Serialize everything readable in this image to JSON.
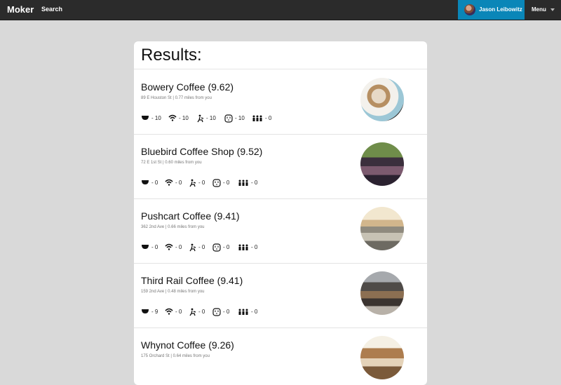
{
  "topbar": {
    "brand": "Moker",
    "search_label": "Search",
    "user_name": "Jason Leibowitz",
    "menu_label": "Menu"
  },
  "colors": {
    "topbar_bg": "#2b2b2b",
    "user_bg": "#0a86b8",
    "page_bg": "#d9d9d9"
  },
  "panel": {
    "title": "Results:"
  },
  "results": [
    {
      "name": "Bowery Coffee (9.62)",
      "meta": "89 E Houston St | 0.77 miles from you",
      "stats": {
        "coffee": "- 10",
        "wifi": "- 10",
        "seating": "- 10",
        "outlets": "- 10",
        "crowd": "- 0"
      }
    },
    {
      "name": "Bluebird Coffee Shop (9.52)",
      "meta": "72 E 1st St | 0.60 miles from you",
      "stats": {
        "coffee": "- 0",
        "wifi": "- 0",
        "seating": "- 0",
        "outlets": "- 0",
        "crowd": "- 0"
      }
    },
    {
      "name": "Pushcart Coffee (9.41)",
      "meta": "362 2nd Ave | 0.66 miles from you",
      "stats": {
        "coffee": "- 0",
        "wifi": "- 0",
        "seating": "- 0",
        "outlets": "- 0",
        "crowd": "- 0"
      }
    },
    {
      "name": "Third Rail Coffee (9.41)",
      "meta": "159 2nd Ave | 0.48 miles from you",
      "stats": {
        "coffee": "- 9",
        "wifi": "- 0",
        "seating": "- 0",
        "outlets": "- 0",
        "crowd": "- 0"
      }
    },
    {
      "name": "Whynot Coffee (9.26)",
      "meta": "175 Orchard St | 0.64 miles from you",
      "stats": {
        "coffee": "",
        "wifi": "",
        "seating": "",
        "outlets": "",
        "crowd": ""
      }
    }
  ],
  "icons": [
    "coffee-cup-icon",
    "wifi-icon",
    "seating-icon",
    "outlet-icon",
    "crowd-icon"
  ]
}
